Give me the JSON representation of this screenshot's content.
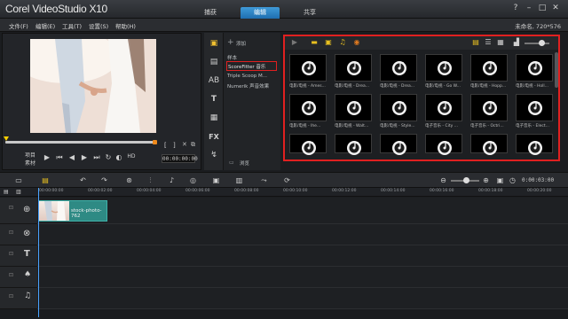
{
  "app": {
    "logo": "Corel VideoStudio X10",
    "tabs": [
      {
        "label": "捕获"
      },
      {
        "label": "编辑"
      },
      {
        "label": "共享"
      }
    ],
    "window_buttons": [
      "?",
      "–",
      "□",
      "✕"
    ]
  },
  "menu": {
    "items": [
      "文件(F)",
      "编辑(E)",
      "工具(T)",
      "设置(S)",
      "帮助(H)"
    ],
    "project_info": "未命名, 720*576"
  },
  "preview": {
    "modes": [
      "项目",
      "素材"
    ],
    "hd_label": "HD",
    "timecode": "00:00:00:00",
    "marker_labels": [
      "[",
      "]"
    ]
  },
  "library": {
    "add_label": "添加",
    "folders": [
      "样本",
      "ScoreFitter 音乐",
      "Triple Scoop M...",
      "Numerik 声音效果"
    ],
    "browse_label": "浏览",
    "items": [
      "电影/电视 - Ames...",
      "电影/电视 - Drea...",
      "电影/电视 - Drea...",
      "电影/电视 - Go W...",
      "电影/电视 - Hopp...",
      "电影/电视 - Holl...",
      "电影/电视 - Ihe...",
      "电影/电视 - Walt...",
      "电影/电视 - Style...",
      "电子音乐 - City ...",
      "电子音乐 - Octri...",
      "电子音乐 - Elect...",
      "",
      "",
      "",
      "",
      "",
      ""
    ]
  },
  "timeline": {
    "timecode": "0:00:03:00",
    "ruler": [
      "00:00:00:00",
      "00:00:02:00",
      "00:00:04:00",
      "00:00:06:00",
      "00:00:08:00",
      "00:00:10:00",
      "00:00:12:00",
      "00:00:14:00",
      "00:00:16:00",
      "00:00:18:00",
      "00:00:20:00"
    ],
    "clip_label": "stock-photo-762"
  },
  "colors": {
    "accent": "#1e6eb0",
    "highlight_box": "#e02020",
    "clip": "#2e8a84",
    "scrub_marker": "#ffd100"
  }
}
